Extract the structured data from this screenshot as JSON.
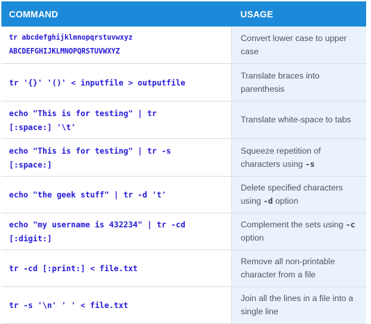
{
  "headers": {
    "command": "COMMAND",
    "usage": "USAGE"
  },
  "rows": [
    {
      "command_line1": "tr abcdefghijklmnopqrstuvwxyz",
      "command_line2": "ABCDEFGHIJKLMNOPQRSTUVWXYZ",
      "usage_before": "Convert lower case to upper case",
      "usage_flag": "",
      "usage_after": ""
    },
    {
      "command_line1": "tr '{}' '()' < inputfile > outputfile",
      "command_line2": "",
      "usage_before": "Translate braces into parenthesis",
      "usage_flag": "",
      "usage_after": ""
    },
    {
      "command_line1": "echo \"This is for testing\" | tr",
      "command_line2": "[:space:] '\\t'",
      "usage_before": "Translate white-space to tabs",
      "usage_flag": "",
      "usage_after": ""
    },
    {
      "command_line1": "echo \"This is for testing\" | tr -s",
      "command_line2": "[:space:]",
      "usage_before": "Squeeze repetition of characters using ",
      "usage_flag": "-s",
      "usage_after": ""
    },
    {
      "command_line1": "echo \"the geek stuff\" | tr -d 't'",
      "command_line2": "",
      "usage_before": "Delete specified characters using ",
      "usage_flag": "-d",
      "usage_after": " option"
    },
    {
      "command_line1": "echo \"my username is 432234\" | tr -cd",
      "command_line2": "[:digit:]",
      "usage_before": "Complement the sets using ",
      "usage_flag": "-c",
      "usage_after": " option"
    },
    {
      "command_line1": "tr -cd [:print:] < file.txt",
      "command_line2": "",
      "usage_before": "Remove all non-printable character from a file",
      "usage_flag": "",
      "usage_after": ""
    },
    {
      "command_line1": "tr -s '\\n' ' ' < file.txt",
      "command_line2": "",
      "usage_before": "Join all the lines in a file into a single line",
      "usage_flag": "",
      "usage_after": ""
    }
  ],
  "colors": {
    "header_bg": "#1c8ad8",
    "command_text": "#2318d6",
    "usage_bg": "#eaf3fc",
    "usage_text": "#4d5560"
  }
}
